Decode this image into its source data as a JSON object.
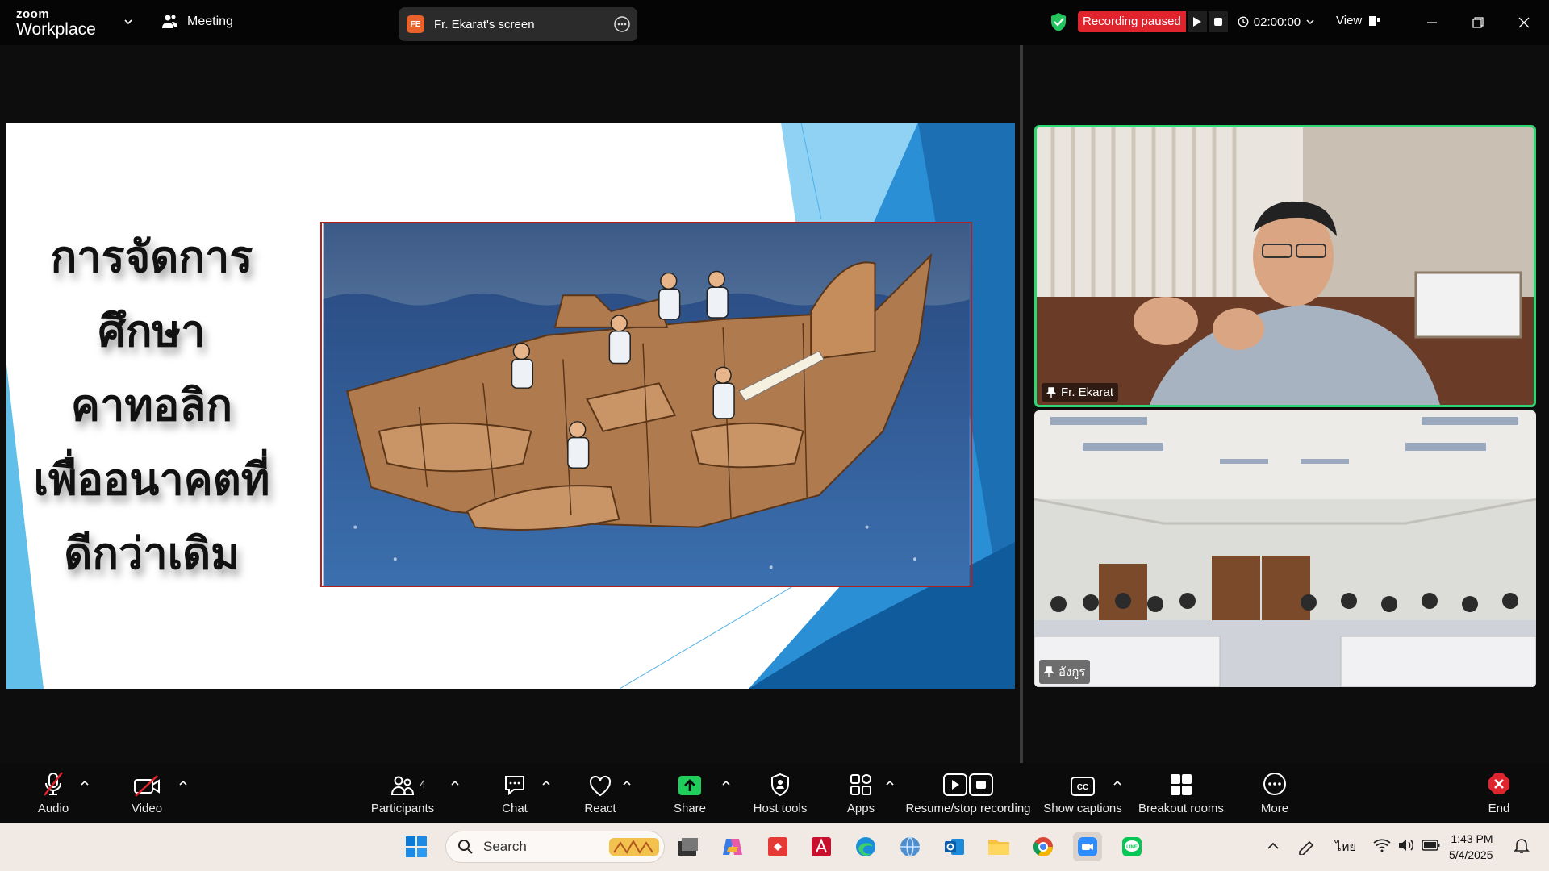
{
  "app": {
    "logo_top": "zoom",
    "logo_bottom": "Workplace",
    "meeting_label": "Meeting"
  },
  "share": {
    "badge": "FE",
    "label": "Fr. Ekarat's screen"
  },
  "recording": {
    "status": "Recording paused",
    "timer": "02:00:00"
  },
  "view_label": "View",
  "slide": {
    "title_lines": [
      "การจัดการ",
      "ศึกษา",
      "คาทอลิก",
      "เพื่ออนาคตที่",
      "ดีกว่าเดิม"
    ]
  },
  "videos": [
    {
      "name": "Fr. Ekarat",
      "active": true
    },
    {
      "name": "อังกูร",
      "active": false
    }
  ],
  "toolbar": {
    "audio": "Audio",
    "video": "Video",
    "participants": "Participants",
    "participants_count": "4",
    "chat": "Chat",
    "react": "React",
    "share": "Share",
    "host_tools": "Host tools",
    "apps": "Apps",
    "resume_stop": "Resume/stop recording",
    "captions": "Show captions",
    "breakout": "Breakout rooms",
    "more": "More",
    "end": "End"
  },
  "taskbar": {
    "search": "Search",
    "language": "ไทย",
    "time": "1:43 PM",
    "date": "5/4/2025"
  },
  "colors": {
    "accent_green": "#2ed573",
    "recording_red": "#e0242e",
    "share_green": "#1fce5b"
  }
}
